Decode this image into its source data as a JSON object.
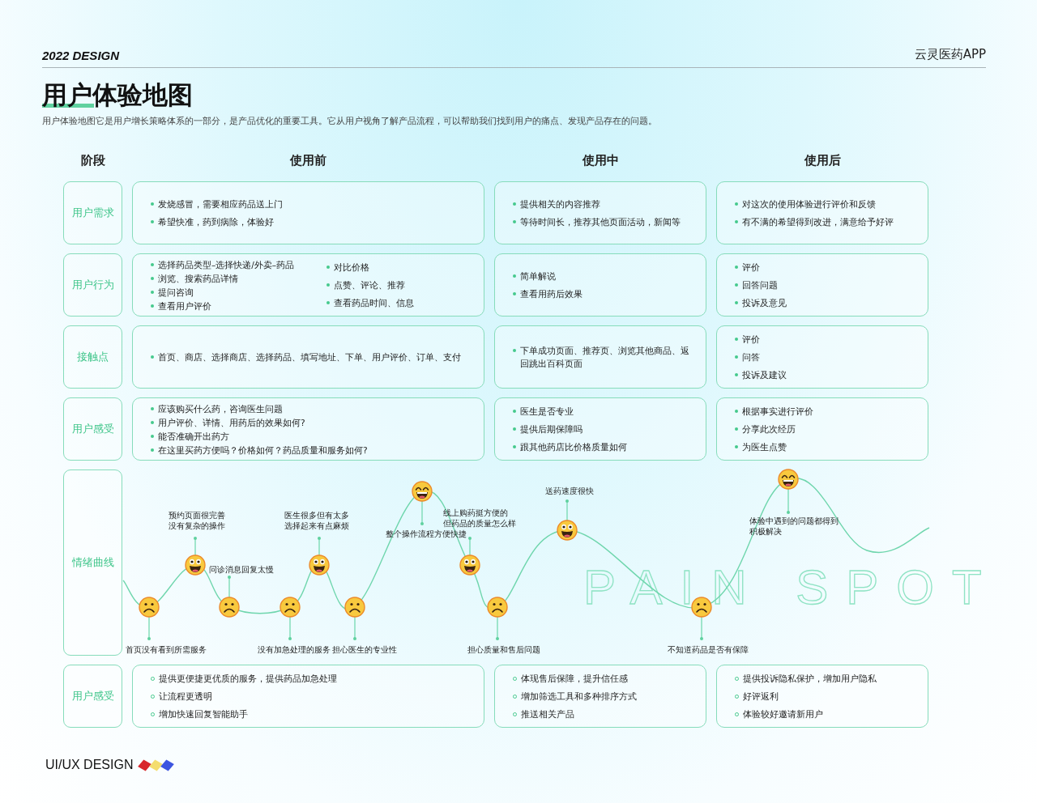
{
  "header": {
    "tag": "2022 DESIGN",
    "app_name": "云灵医药APP"
  },
  "title": "用户体验地图",
  "intro": "用户体验地图它是用户增长策略体系的一部分，是产品优化的重要工具。它从用户视角了解产品流程，可以帮助我们找到用户的痛点、发现产品存在的问题。",
  "table": {
    "columns": [
      "阶段",
      "使用前",
      "使用中",
      "使用后"
    ],
    "rows": [
      {
        "label": "用户需求",
        "kind": "list",
        "hollow": false,
        "cells": [
          {
            "columns": [
              [
                "发烧感冒，需要相应药品送上门",
                "希望快准，药到病除，体验好"
              ]
            ]
          },
          {
            "columns": [
              [
                "提供相关的内容推荐",
                "等待时间长，推荐其他页面活动，新闻等"
              ]
            ]
          },
          {
            "columns": [
              [
                "对这次的使用体验进行评价和反馈",
                "有不满的希望得到改进，满意给予好评"
              ]
            ]
          }
        ]
      },
      {
        "label": "用户行为",
        "kind": "list",
        "hollow": false,
        "cells": [
          {
            "columns": [
              [
                "选择药品类型–选择快递/外卖–药品",
                "浏览、搜索药品详情",
                "提问咨询",
                "查看用户评价"
              ],
              [
                "对比价格",
                "点赞、评论、推荐",
                "查看药品时间、信息"
              ]
            ]
          },
          {
            "columns": [
              [
                "简单解说",
                "查看用药后效果"
              ]
            ]
          },
          {
            "columns": [
              [
                "评价",
                "回答问题",
                "投诉及意见"
              ]
            ]
          }
        ]
      },
      {
        "label": "接触点",
        "kind": "list",
        "hollow": false,
        "cells": [
          {
            "columns": [
              [
                "首页、商店、选择商店、选择药品、填写地址、下单、用户评价、订单、支付"
              ]
            ]
          },
          {
            "columns": [
              [
                "下单成功页面、推荐页、浏览其他商品、返回跳出百科页面"
              ]
            ]
          },
          {
            "columns": [
              [
                "评价",
                "问答",
                "投诉及建议"
              ]
            ]
          }
        ]
      },
      {
        "label": "用户感受",
        "kind": "list",
        "hollow": false,
        "cells": [
          {
            "columns": [
              [
                "应该购买什么药，咨询医生问题",
                "用户评价、详情、用药后的效果如何?",
                "能否准确开出药方",
                "在这里买药方便吗？价格如何？药品质量和服务如何?"
              ]
            ]
          },
          {
            "columns": [
              [
                "医生是否专业",
                "提供后期保障吗",
                "跟其他药店比价格质量如何"
              ]
            ]
          },
          {
            "columns": [
              [
                "根据事实进行评价",
                "分享此次经历",
                "为医生点赞"
              ]
            ]
          }
        ]
      },
      {
        "label": "情绪曲线",
        "kind": "curve",
        "background_text": "PAIN SPOT",
        "points": [
          {
            "kind": "sad",
            "lines": [
              "首页没有看到所需服务"
            ]
          },
          {
            "kind": "happy",
            "lines": [
              "预约页面很完善",
              "没有复杂的操作"
            ]
          },
          {
            "kind": "sad",
            "lines": [
              "问诊消息回复太慢"
            ]
          },
          {
            "kind": "sad",
            "lines": [
              "没有加急处理的服务"
            ]
          },
          {
            "kind": "happy",
            "lines": [
              "医生很多但有太多",
              "选择起来有点麻烦"
            ]
          },
          {
            "kind": "sad",
            "lines": [
              "担心医生的专业性"
            ]
          },
          {
            "kind": "laugh",
            "lines": [
              "整个操作流程方便快捷"
            ]
          },
          {
            "kind": "happy",
            "lines": [
              "线上购药挺方便的",
              "但药品的质量怎么样"
            ]
          },
          {
            "kind": "sad",
            "lines": [
              "担心质量和售后问题"
            ]
          },
          {
            "kind": "happy",
            "lines": [
              "送药速度很快"
            ]
          },
          {
            "kind": "sad",
            "lines": [
              "不知道药品是否有保障"
            ]
          },
          {
            "kind": "laugh",
            "lines": [
              "体验中遇到的问题都得到积极解决"
            ]
          }
        ]
      },
      {
        "label": "用户感受",
        "kind": "list",
        "hollow": true,
        "cells": [
          {
            "columns": [
              [
                "提供更便捷更优质的服务，提供药品加急处理",
                "让流程更透明",
                "增加快速回复智能助手"
              ]
            ]
          },
          {
            "columns": [
              [
                "体现售后保障，提升信任感",
                "增加筛选工具和多种排序方式",
                "推送相关产品"
              ]
            ]
          },
          {
            "columns": [
              [
                "提供投诉隐私保护，增加用户隐私",
                "好评返利",
                "体验较好邀请新用户"
              ]
            ]
          }
        ]
      }
    ]
  },
  "footer": {
    "brand": "UI/UX DESIGN",
    "swatches": [
      {
        "color": "#d8262c"
      },
      {
        "color": "#f4dd6e"
      },
      {
        "color": "#3d55e0"
      }
    ]
  }
}
